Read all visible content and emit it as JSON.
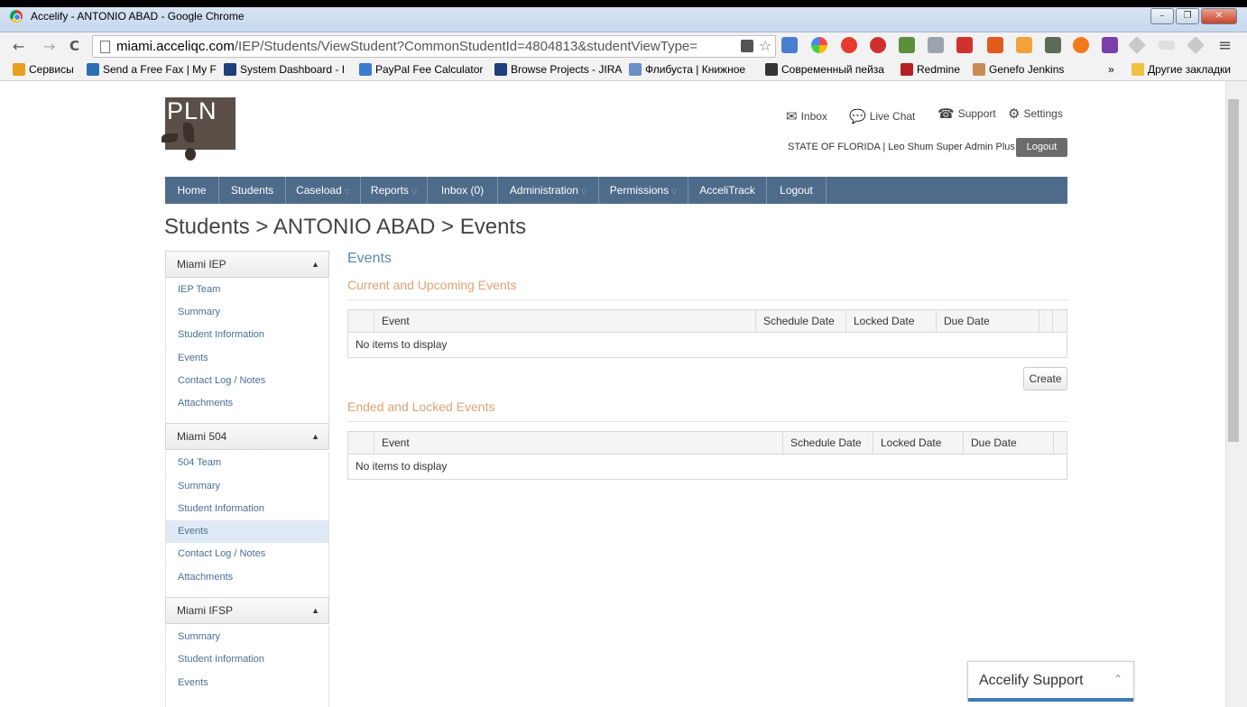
{
  "window": {
    "title": "Accelify - ANTONIO ABAD - Google Chrome",
    "min": "–",
    "max": "❐",
    "close": "✕"
  },
  "toolbar": {
    "back": "←",
    "forward": "→",
    "reload": "C",
    "url_host": "miami.acceliqc.com",
    "url_path": "/IEP/Students/ViewStudent?CommonStudentId=4804813&studentViewType=",
    "menu": "≡"
  },
  "bookmarks": [
    {
      "label": "Сервисы",
      "color": "#e8a01e"
    },
    {
      "label": "Send a Free Fax | My F",
      "color": "#2a6fb5"
    },
    {
      "label": "System Dashboard - I",
      "color": "#1d3f7a"
    },
    {
      "label": "PayPal Fee Calculator",
      "color": "#3b7ccf"
    },
    {
      "label": "Browse Projects - JIRA",
      "color": "#1d3f7a"
    },
    {
      "label": "Флибуста | Книжное",
      "color": "#6a8fc7"
    },
    {
      "label": "Современный пейза",
      "color": "#333333"
    },
    {
      "label": "Redmine",
      "color": "#b32024"
    },
    {
      "label": "Genefo Jenkins",
      "color": "#c98b52"
    }
  ],
  "bookmarks_more": "»",
  "bookmarks_other": "Другие закладки",
  "header": {
    "logo_text": "PLN",
    "inbox": "Inbox",
    "live_chat": "Live Chat",
    "support": "Support",
    "settings": "Settings",
    "user_line": "STATE OF FLORIDA  |  Leo Shum Super Admin Plus",
    "logout_button": "Logout"
  },
  "nav": [
    {
      "label": "Home",
      "caret": false
    },
    {
      "label": "Students",
      "caret": false
    },
    {
      "label": "Caseload",
      "caret": true
    },
    {
      "label": "Reports",
      "caret": true
    },
    {
      "label": "Inbox (0)",
      "caret": false
    },
    {
      "label": "Administration",
      "caret": true
    },
    {
      "label": "Permissions",
      "caret": true
    },
    {
      "label": "AcceliTrack",
      "caret": false
    },
    {
      "label": "Logout",
      "caret": false
    }
  ],
  "breadcrumb": "Students > ANTONIO ABAD > Events",
  "sidebar": {
    "groups": [
      {
        "title": "Miami IEP",
        "items": [
          "IEP Team",
          "Summary",
          "Student Information",
          "Events",
          "Contact Log / Notes",
          "Attachments"
        ]
      },
      {
        "title": "Miami 504",
        "items": [
          "504 Team",
          "Summary",
          "Student Information",
          "Events",
          "Contact Log / Notes",
          "Attachments"
        ]
      },
      {
        "title": "Miami IFSP",
        "items": [
          "Summary",
          "Student Information",
          "Events"
        ]
      }
    ],
    "collapse_glyph": "▲"
  },
  "main": {
    "title": "Events",
    "current_title": "Current and Upcoming Events",
    "ended_title": "Ended and Locked Events",
    "columns": [
      "Event",
      "Schedule Date",
      "Locked Date",
      "Due Date"
    ],
    "empty_text": "No items to display",
    "create_button": "Create"
  },
  "support_widget": {
    "label": "Accelify Support",
    "chevron": "⌃"
  }
}
